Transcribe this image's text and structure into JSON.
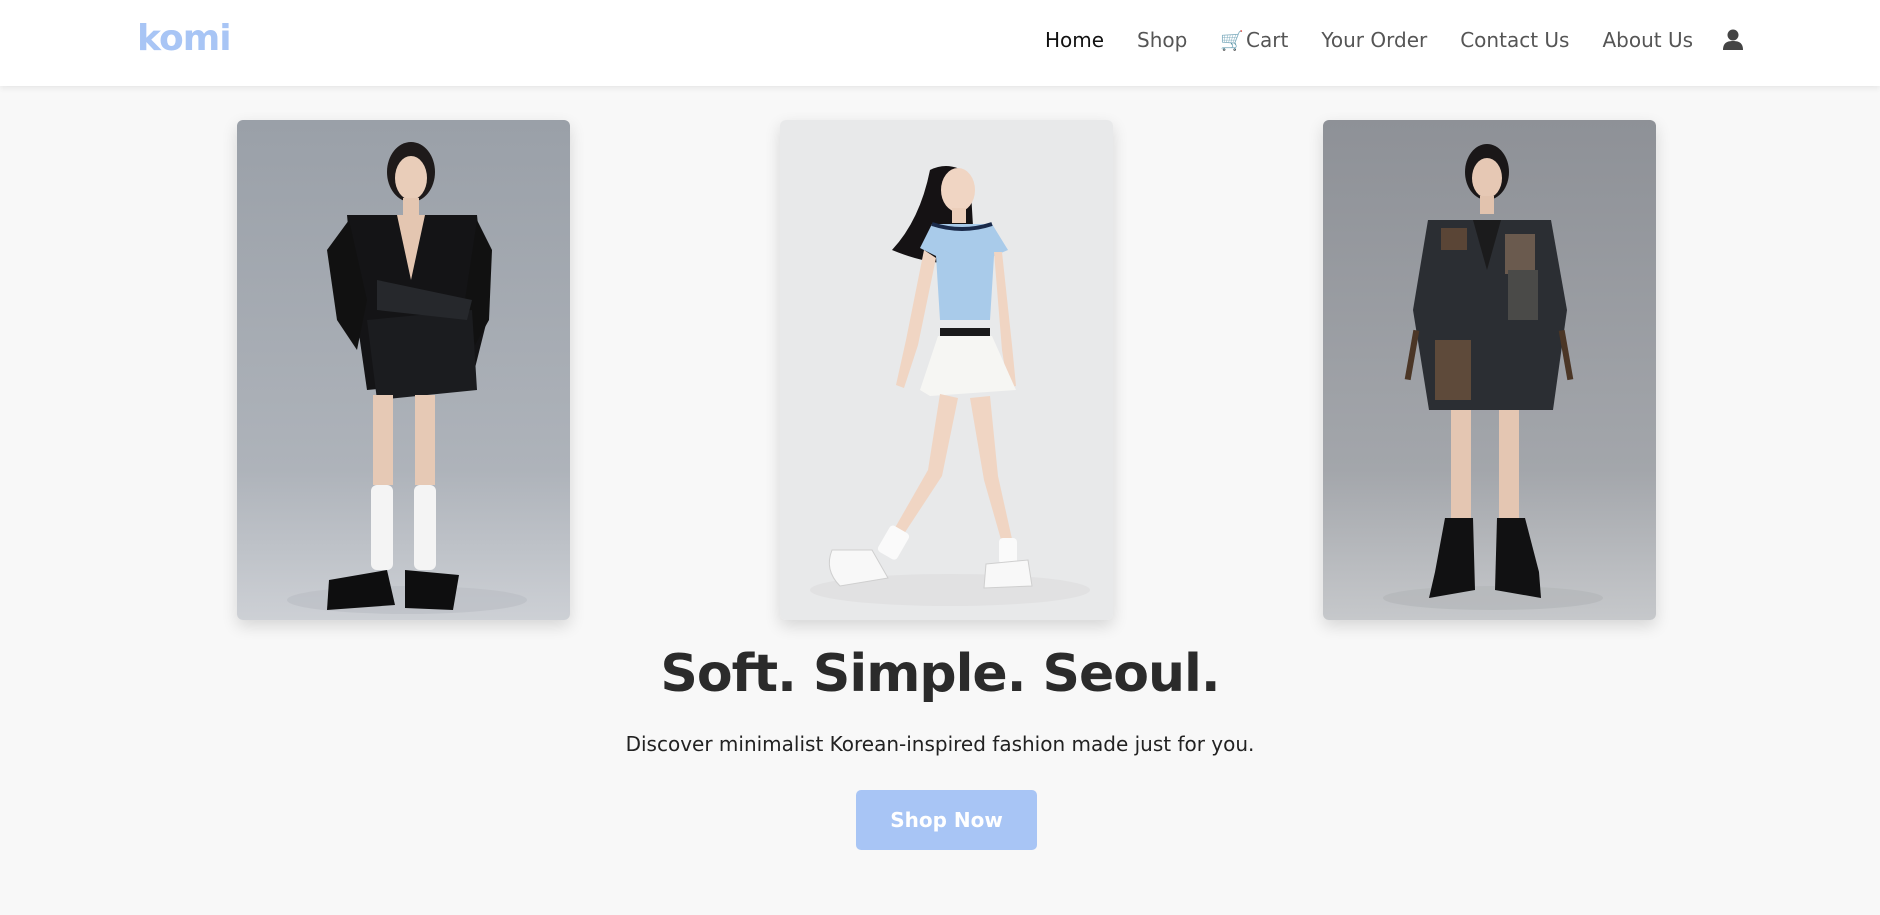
{
  "header": {
    "logo": "komi",
    "nav": [
      {
        "label": "Home",
        "active": true
      },
      {
        "label": "Shop"
      },
      {
        "label": "Cart",
        "icon": "cart-icon"
      },
      {
        "label": "Your Order"
      },
      {
        "label": "Contact Us"
      },
      {
        "label": "About Us"
      }
    ],
    "account_icon": "user-icon"
  },
  "gallery": [
    {
      "description": "Model in black leather wrap blazer dress with white knee socks and platform sandals"
    },
    {
      "description": "Model walking in light blue crop tee and white pleated mini skirt with white sneakers"
    },
    {
      "description": "Model in dark patchwork blazer jacket with brown leather pockets and black combat boots"
    }
  ],
  "hero": {
    "headline": "Soft. Simple. Seoul.",
    "subtitle": "Discover minimalist Korean-inspired fashion made just for you.",
    "cta_label": "Shop Now"
  },
  "colors": {
    "accent": "#a8c5f5",
    "background": "#f8f8f8",
    "header_bg": "#ffffff",
    "text_dark": "#2b2b2b"
  }
}
